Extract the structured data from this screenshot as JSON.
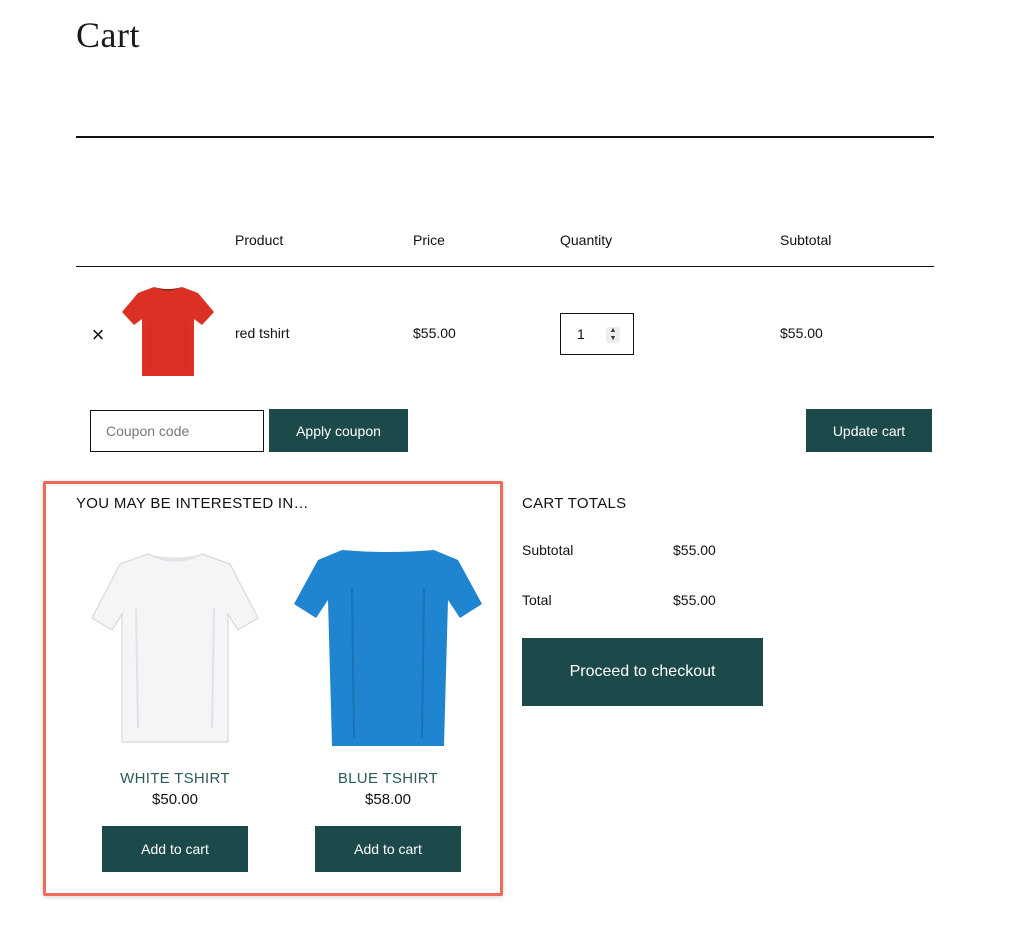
{
  "page": {
    "title": "Cart"
  },
  "table": {
    "headers": {
      "product": "Product",
      "price": "Price",
      "quantity": "Quantity",
      "subtotal": "Subtotal"
    },
    "rows": [
      {
        "remove": "×",
        "product_image": "red-tshirt",
        "product_color": "#dd3024",
        "name": "red tshirt",
        "price": "$55.00",
        "quantity": "1",
        "subtotal": "$55.00"
      }
    ]
  },
  "coupon": {
    "placeholder": "Coupon code",
    "value": "",
    "apply_label": "Apply coupon"
  },
  "update_cart_label": "Update cart",
  "interest": {
    "title": "YOU MAY BE INTERESTED IN…",
    "products": [
      {
        "name": "WHITE TSHIRT",
        "price": "$50.00",
        "image": "white-tshirt",
        "color": "#f4f5f7",
        "button": "Add to cart"
      },
      {
        "name": "BLUE TSHIRT",
        "price": "$58.00",
        "image": "blue-tshirt",
        "color": "#1f85d0",
        "button": "Add to cart"
      }
    ]
  },
  "totals": {
    "title": "CART TOTALS",
    "subtotal_label": "Subtotal",
    "subtotal_value": "$55.00",
    "total_label": "Total",
    "total_value": "$55.00",
    "checkout_label": "Proceed to checkout"
  },
  "colors": {
    "button_bg": "#1c4a4b",
    "button_text": "#ffffff",
    "link": "#2b5a5b",
    "highlight_border": "#ee6a5b"
  }
}
